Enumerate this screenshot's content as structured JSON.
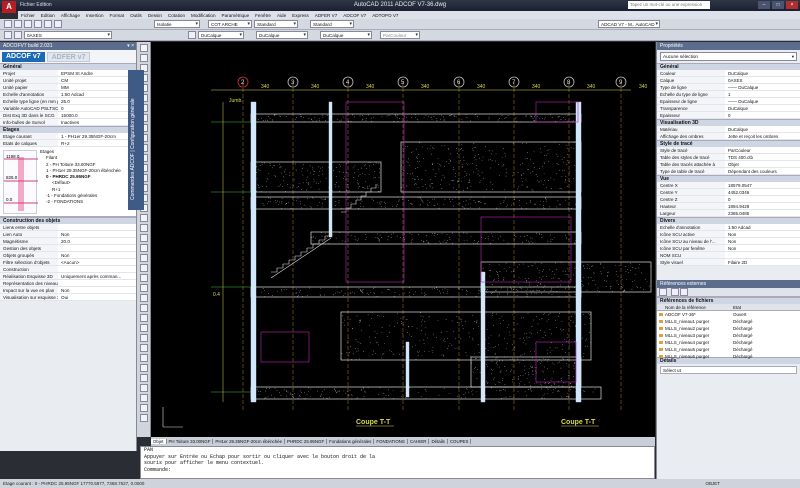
{
  "app": {
    "title": "AutoCAD 2011    ADCOF V7-36.dwg",
    "logo": "A",
    "quick_access": "Fichier  Edition",
    "search_placeholder": "Tapez un mot-clé ou une expression"
  },
  "menu": [
    "Fichier",
    "Edition",
    "Affichage",
    "Insertion",
    "Format",
    "Outils",
    "Dessin",
    "Cotation",
    "Modification",
    "Paramétrique",
    "Fenêtre",
    "Aide",
    "Express",
    "ADFER V7",
    "ADCOF V7",
    "ADTOPO V7"
  ],
  "toolbar1": {
    "style_combo": "Isolatie",
    "text_combo": "COT ARCHE",
    "dim_style": "Standard",
    "table_style": "Standard",
    "right_combo": "ADCAD V7 - M.. AutoCAD 200"
  },
  "toolbar2": {
    "layer": "0AXES",
    "color": "DuCalque",
    "linetype": "DuCalque",
    "lineweight": "DuCalque",
    "plotstyle": "ParCouleur"
  },
  "left": {
    "title": "ADCOFV7 build 2.031",
    "tab_on": "ADCOF v7",
    "tab_off": "ADFER v7",
    "general_header": "Général",
    "general": [
      {
        "k": "Projet",
        "v": "EPSM St Andre"
      },
      {
        "k": "Unité projet",
        "v": "CM"
      },
      {
        "k": "Unité papier",
        "v": "MM"
      },
      {
        "k": "Echelle d'annotation",
        "v": "1:50  Adcad"
      },
      {
        "k": "Echelle type ligne (en mm p...",
        "v": "25.0"
      },
      {
        "k": "Variable AutoCAD PSLTSC...",
        "v": "0"
      },
      {
        "k": "Dist Exq 3D dans le SCG",
        "v": "15000.0"
      },
      {
        "k": "Info-bulles de Survol",
        "v": "Inactives"
      }
    ],
    "levels_header": "Etages",
    "levels_general": [
      {
        "k": "Etage courant",
        "v": "1 - PH1er 29.35NGF-20cm"
      },
      {
        "k": "Etats de calques",
        "v": "R+2"
      }
    ],
    "level_values": [
      "1198.0",
      "825.0",
      "0.0"
    ],
    "tree": [
      "Etages",
      "Filant",
      "2 - PH Toiture 33.00NGF",
      "1 - PH1er 29.35NGF-20cm ébénchée",
      "0 - PHRDC 25.95NGF",
      "<Défaut>",
      "R+1",
      "-1 - Fondations générales",
      "-2 - FONDATIONS"
    ],
    "construction_header": "Construction des objets",
    "construction": [
      {
        "k": "Liens entre objets",
        "v": ""
      },
      {
        "k": "Lien Auto",
        "v": "Non"
      },
      {
        "k": "Magnétisme",
        "v": "20.0"
      },
      {
        "k": "Gestion des objets",
        "v": ""
      },
      {
        "k": "Objets groupés",
        "v": "Non"
      },
      {
        "k": "Filtre sélection d'objets",
        "v": "<Aucun>"
      },
      {
        "k": "Construction",
        "v": ""
      },
      {
        "k": "Réalisation Esquisse 3D",
        "v": "Uniquement après comman..."
      },
      {
        "k": "Représentation des niveaux",
        "v": ""
      },
      {
        "k": "Impact sur la vue en plan",
        "v": "Non"
      },
      {
        "k": "Visualisation sur esquisse 3D",
        "v": "Oui"
      }
    ]
  },
  "vstrip_title": "Commandes ADCOF | Configuration générale",
  "drawing": {
    "dims": [
      "340",
      "340",
      "340",
      "340",
      "340",
      "340",
      "340",
      "340"
    ],
    "grid_labels": [
      "2",
      "3",
      "4",
      "5",
      "6",
      "7",
      "8",
      "9"
    ],
    "titles": [
      "Coupe T-T",
      "Coupe T-T"
    ],
    "level_text": [
      "Jumb.",
      "0.4"
    ]
  },
  "layout_tabs": [
    "Objet",
    "PH Toiture 33.00NGF",
    "PH1er 29.35NGF-20cm ébénchée",
    "PHRDC 25.95NGF",
    "Fondations générales",
    "FONDATIONS",
    "CAHIER",
    "Détails",
    "COUPES"
  ],
  "command": {
    "lines": [
      "PAN",
      "Appuyer sur Entrée ou Echap pour sortir ou cliquer avec le bouton droit de la",
      "souris pour afficher le menu contextuel.",
      "Commande:"
    ]
  },
  "status": {
    "left": "Etage courant : 0 - PHRDC 25.95NGF   17770.5877, 7368.7627, 0.0000",
    "right": "OBJET"
  },
  "right": {
    "title": "Propriétés",
    "selection": "Aucune sélection",
    "sections": [
      {
        "h": "Général",
        "rows": [
          {
            "k": "Couleur",
            "v": "DuCalque"
          },
          {
            "k": "Calque",
            "v": "0AXES"
          },
          {
            "k": "Type de ligne",
            "v": "—— DuCalque"
          },
          {
            "k": "Echelle du type de ligne",
            "v": "1"
          },
          {
            "k": "Epaisseur de ligne",
            "v": "—— DuCalque"
          },
          {
            "k": "Transparence",
            "v": "DuCalque"
          },
          {
            "k": "Epaisseur",
            "v": "0"
          }
        ]
      },
      {
        "h": "Visualisation 3D",
        "rows": [
          {
            "k": "Matériau",
            "v": "DuCalque"
          },
          {
            "k": "Affichage des ombres",
            "v": "Jette et reçoit les ombres"
          }
        ]
      },
      {
        "h": "Style de tracé",
        "rows": [
          {
            "k": "Style de tracé",
            "v": "ParCouleur"
          },
          {
            "k": "Table des styles de tracé",
            "v": "TDS 400.ctb"
          },
          {
            "k": "Table des tracés attachée à",
            "v": "Objet"
          },
          {
            "k": "Type de table de tracé",
            "v": "Dépendant des couleurs"
          }
        ]
      },
      {
        "h": "Vue",
        "rows": [
          {
            "k": "Centre X",
            "v": "18579.0547"
          },
          {
            "k": "Centre Y",
            "v": "4452.0346"
          },
          {
            "k": "Centre Z",
            "v": "0"
          },
          {
            "k": "Hauteur",
            "v": "1894.9429"
          },
          {
            "k": "Largeur",
            "v": "2385.0485"
          }
        ]
      },
      {
        "h": "Divers",
        "rows": [
          {
            "k": "Echelle d'annotation",
            "v": "1:50  Adcad"
          },
          {
            "k": "Icône SCU active",
            "v": "Non"
          },
          {
            "k": "Icône SCU au niveau de l'...",
            "v": "Non"
          },
          {
            "k": "Icône SCU par fenêtre",
            "v": "Non"
          },
          {
            "k": "NOM SCU",
            "v": ""
          },
          {
            "k": "Style visuel",
            "v": "Filaire 2D"
          }
        ]
      }
    ],
    "xref_title": "Références externes",
    "files_header": "Références de fichiers",
    "col_name": "Nom de la référence",
    "col_state": "Etat",
    "files": [
      {
        "n": "ADCOF V7-36*",
        "s": "Ouvert"
      },
      {
        "n": "MLLS_niveau1 purger",
        "s": "Déchargé"
      },
      {
        "n": "MLLS_niveau2 purger",
        "s": "Déchargé"
      },
      {
        "n": "MLLS_niveau3 purger",
        "s": "Déchargé"
      },
      {
        "n": "MLLS_niveau4 purger",
        "s": "Déchargé"
      },
      {
        "n": "MLLS_niveau5 purger",
        "s": "Déchargé"
      },
      {
        "n": "MLLS_niveau6 purger",
        "s": "Déchargé"
      }
    ],
    "details_title": "Détails",
    "details_text": "Sélect ut"
  },
  "colors": {
    "canvas": "#000000",
    "accent": "#1c6ab3",
    "cad_yellow": "#d8d84a",
    "cad_magenta": "#c020c0",
    "cad_white": "#e0e0e0"
  }
}
